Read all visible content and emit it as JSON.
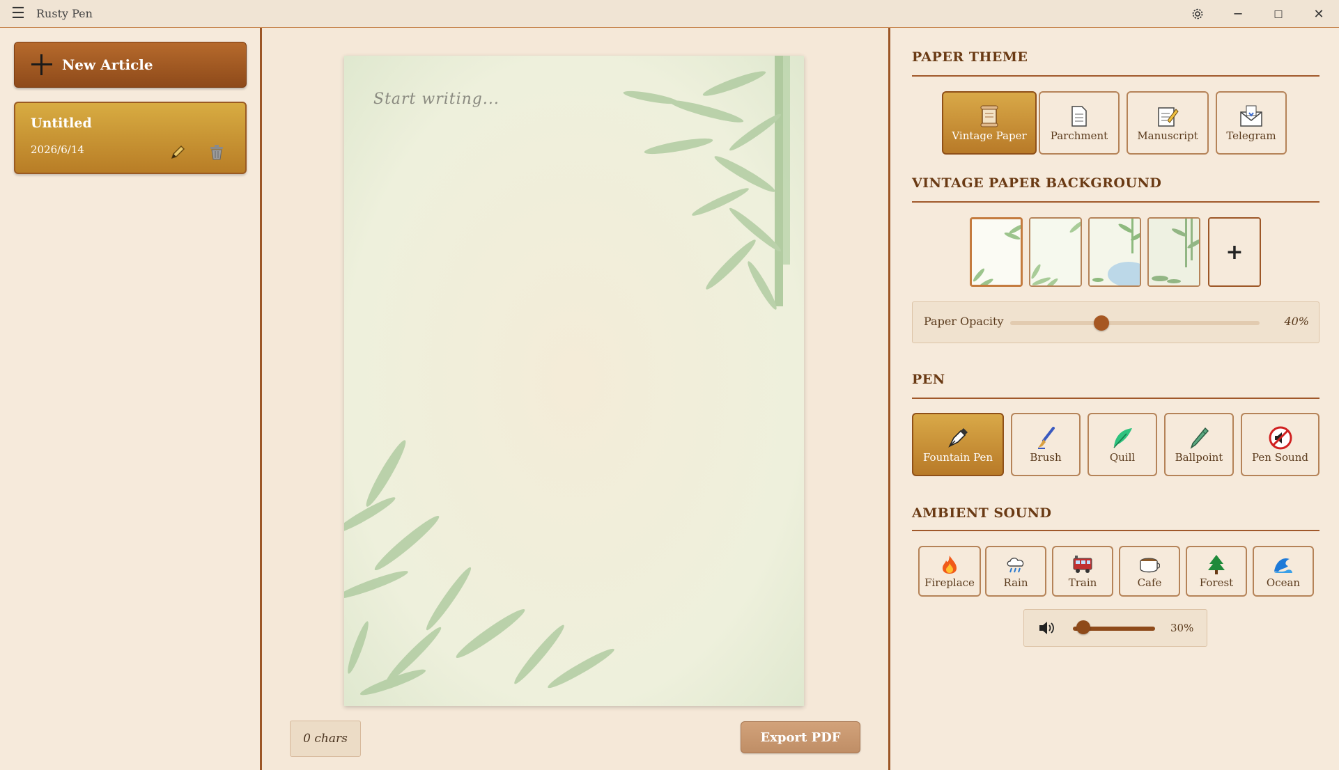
{
  "app": {
    "title": "Rusty Pen"
  },
  "window_controls": {
    "settings_icon": "gear-icon",
    "minimize_glyph": "─",
    "maximize_glyph": "□",
    "close_glyph": "✕"
  },
  "sidebar": {
    "new_article_label": "New Article",
    "articles": [
      {
        "title": "Untitled",
        "date": "2026/6/14"
      }
    ]
  },
  "editor": {
    "placeholder": "Start writing...",
    "char_count": "0 chars",
    "export_label": "Export PDF"
  },
  "panel": {
    "paper_theme": {
      "heading": "PAPER THEME",
      "options": [
        {
          "label": "Vintage Paper",
          "icon": "scroll-icon",
          "active": true
        },
        {
          "label": "Parchment",
          "icon": "document-icon",
          "active": false
        },
        {
          "label": "Manuscript",
          "icon": "memo-icon",
          "active": false
        },
        {
          "label": "Telegram",
          "icon": "envelope-icon",
          "active": false
        }
      ]
    },
    "background": {
      "heading": "VINTAGE PAPER BACKGROUND",
      "add_label": "+",
      "selected_index": 0,
      "opacity_label": "Paper Opacity",
      "opacity_value": "40%",
      "opacity_fraction": 0.4
    },
    "pen": {
      "heading": "PEN",
      "options": [
        {
          "label": "Fountain Pen",
          "icon": "fountain-pen-icon",
          "active": true
        },
        {
          "label": "Brush",
          "icon": "paintbrush-icon",
          "active": false
        },
        {
          "label": "Quill",
          "icon": "feather-icon",
          "active": false
        },
        {
          "label": "Ballpoint",
          "icon": "pen-icon",
          "active": false
        },
        {
          "label": "Pen Sound",
          "icon": "muted-speaker-icon",
          "active": false
        }
      ]
    },
    "ambient": {
      "heading": "AMBIENT SOUND",
      "options": [
        {
          "label": "Fireplace",
          "icon": "fire-icon"
        },
        {
          "label": "Rain",
          "icon": "rain-cloud-icon"
        },
        {
          "label": "Train",
          "icon": "train-icon"
        },
        {
          "label": "Cafe",
          "icon": "coffee-icon"
        },
        {
          "label": "Forest",
          "icon": "tree-icon"
        },
        {
          "label": "Ocean",
          "icon": "wave-icon"
        }
      ],
      "volume_value": "30%",
      "volume_fraction": 0.3
    }
  },
  "colors": {
    "accent_dark": "#8e4a1a",
    "accent_gold": "#d8ac42",
    "rule": "#a0582a",
    "background": "#f5e8d8"
  }
}
